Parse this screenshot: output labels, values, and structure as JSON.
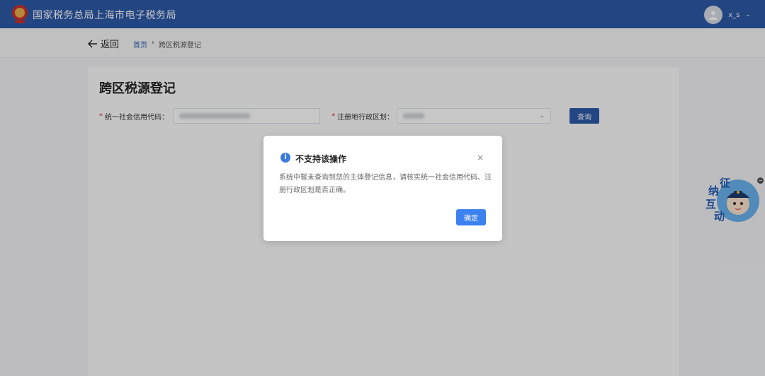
{
  "header": {
    "title": "国家税务总局上海市电子税务局",
    "username": "x_s"
  },
  "breadcrumb": {
    "back_label": "返回",
    "home": "首页",
    "separator": "›",
    "current": "跨区税源登记"
  },
  "page": {
    "title": "跨区税源登记",
    "credit_code_label": "统一社会信用代码：",
    "region_label": "注册地行政区划：",
    "query_button": "查询",
    "required_mark": "*"
  },
  "widget": {
    "chars": [
      "征",
      "纳",
      "互",
      "动"
    ]
  },
  "dialog": {
    "title": "不支持该操作",
    "body": "系统中暂未查询到您的主体登记信息，请核实统一社会信用代码、注册行政区划是否正确。",
    "ok_button": "确定",
    "close": "×",
    "info_icon": "i"
  },
  "colors": {
    "header_bg": "#2d5aa8",
    "primary": "#3b82f0"
  }
}
